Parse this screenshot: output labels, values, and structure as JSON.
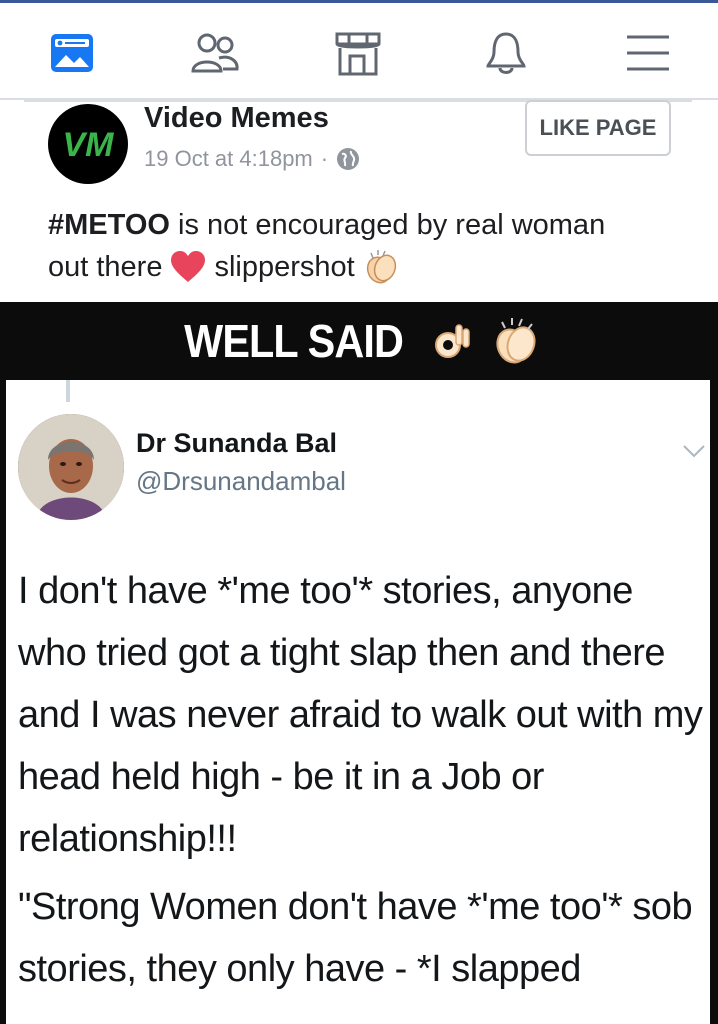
{
  "nav": {
    "items": [
      {
        "name": "news-feed-icon"
      },
      {
        "name": "friends-icon"
      },
      {
        "name": "marketplace-icon"
      },
      {
        "name": "notifications-icon"
      },
      {
        "name": "menu-icon"
      }
    ],
    "accent": "#3b5998",
    "active_color": "#1877f2"
  },
  "post": {
    "avatar_text": "VM",
    "page_name": "Video Memes",
    "timestamp": "19 Oct at 4:18pm",
    "separator": "·",
    "like_button": "LIKE PAGE",
    "hashtag": "#METOO",
    "text_line1": " is not encouraged by real woman",
    "text_line2a": "out there",
    "text_line2b": "slippershot"
  },
  "meme": {
    "title": "WELL SAID",
    "tweet": {
      "name": "Dr Sunanda Bal",
      "handle": "@Drsunandambal",
      "paragraph1": "I don't have *'me too'* stories, anyone who tried got a tight slap then and there and I was never afraid to walk out with my head held high - be it in a Job or relationship!!!",
      "paragraph2": "\"Strong Women don't have *'me too'* sob stories, they only have - *I slapped"
    }
  }
}
